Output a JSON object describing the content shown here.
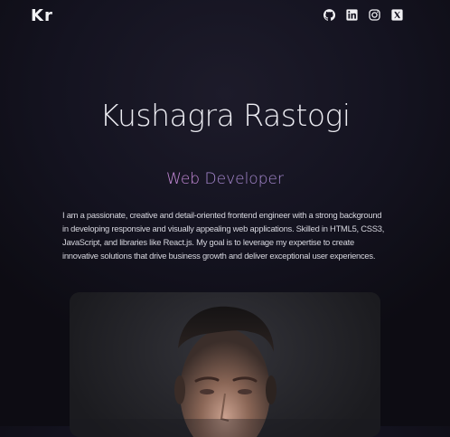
{
  "header": {
    "logo_text": "Kr",
    "social_icons": [
      "github-icon",
      "linkedin-icon",
      "instagram-icon",
      "x-twitter-icon"
    ]
  },
  "hero": {
    "name": "Kushagra Rastogi",
    "role_word_1": "Web",
    "role_word_2": "Developer",
    "bio": "I am a passionate, creative and detail-oriented frontend engineer with a strong background in developing responsive and visually appealing web applications. Skilled in HTML5, CSS3, JavaScript, and libraries like React.js. My goal is to leverage my expertise to create innovative solutions that drive business growth and deliver exceptional user experiences."
  },
  "colors": {
    "background": "#141320",
    "role_accent_1": "#c58ad8",
    "role_accent_2": "#a98ad2"
  }
}
